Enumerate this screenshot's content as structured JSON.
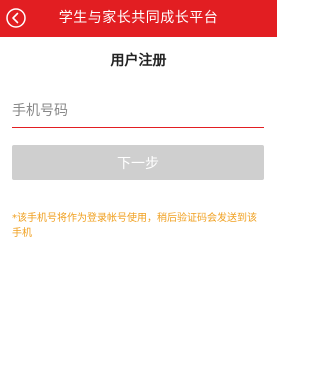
{
  "header": {
    "title": "学生与家长共同成长平台",
    "back_icon": "back-arrow-icon",
    "background_color": "#e21e22"
  },
  "page": {
    "title": "用户注册"
  },
  "form": {
    "phone_placeholder": "手机号码",
    "phone_value": "",
    "next_label": "下一步"
  },
  "hint": {
    "text": "*该手机号将作为登录帐号使用，稍后验证码会发送到该手机"
  },
  "colors": {
    "accent": "#e21e22",
    "button_disabled": "#cfcfcf",
    "hint": "#f0a020"
  }
}
